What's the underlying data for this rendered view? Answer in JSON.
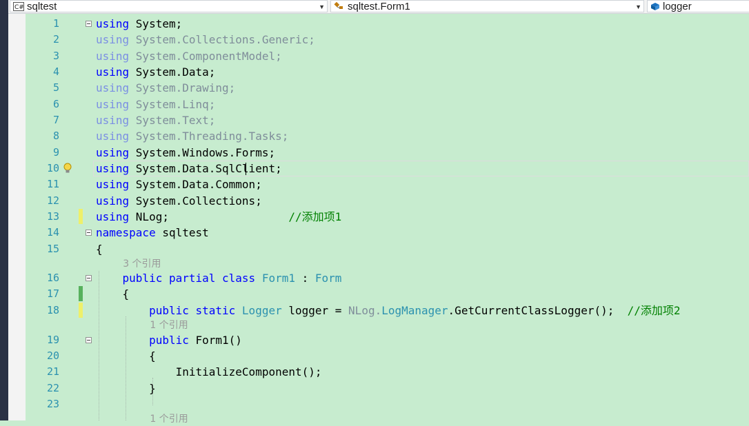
{
  "nav": {
    "project": "sqltest",
    "project_icon": "C#",
    "class": "sqltest.Form1",
    "member": "logger"
  },
  "colors": {
    "keyword": "#0000ff",
    "type": "#2b91af",
    "comment": "#008000",
    "line_number": "#2b91af",
    "background": "#c7eccf",
    "change_saved": "#57b15d",
    "change_unsaved": "#eef06a"
  },
  "lines": [
    {
      "num": "1",
      "parts": [
        [
          "kw",
          "using"
        ],
        [
          "",
          "System;"
        ]
      ]
    },
    {
      "num": "2",
      "parts": [
        [
          "dimkw",
          "using"
        ],
        [
          "dim",
          "System.Collections.Generic;"
        ]
      ]
    },
    {
      "num": "3",
      "parts": [
        [
          "dimkw",
          "using"
        ],
        [
          "dim",
          "System.ComponentModel;"
        ]
      ]
    },
    {
      "num": "4",
      "parts": [
        [
          "kw",
          "using"
        ],
        [
          "",
          "System.Data;"
        ]
      ]
    },
    {
      "num": "5",
      "parts": [
        [
          "dimkw",
          "using"
        ],
        [
          "dim",
          "System.Drawing;"
        ]
      ]
    },
    {
      "num": "6",
      "parts": [
        [
          "dimkw",
          "using"
        ],
        [
          "dim",
          "System.Linq;"
        ]
      ]
    },
    {
      "num": "7",
      "parts": [
        [
          "dimkw",
          "using"
        ],
        [
          "dim",
          "System.Text;"
        ]
      ]
    },
    {
      "num": "8",
      "parts": [
        [
          "dimkw",
          "using"
        ],
        [
          "dim",
          "System.Threading.Tasks;"
        ]
      ]
    },
    {
      "num": "9",
      "parts": [
        [
          "kw",
          "using"
        ],
        [
          "",
          "System.Windows.Forms;"
        ]
      ]
    },
    {
      "num": "10",
      "parts": [
        [
          "kw",
          "using"
        ],
        [
          "",
          "System.Data.SqlClient;"
        ]
      ]
    },
    {
      "num": "11",
      "parts": [
        [
          "kw",
          "using"
        ],
        [
          "",
          "System.Data.Common;"
        ]
      ]
    },
    {
      "num": "12",
      "parts": [
        [
          "kw",
          "using"
        ],
        [
          "",
          "System.Collections;"
        ]
      ]
    },
    {
      "num": "13",
      "parts": [
        [
          "kw",
          "using"
        ],
        [
          "",
          "NLog;                  "
        ],
        [
          "cm",
          "//添加项1"
        ]
      ]
    },
    {
      "num": "14",
      "parts": [
        [
          "kw",
          "namespace"
        ],
        [
          "",
          "sqltest"
        ]
      ]
    },
    {
      "num": "15",
      "parts": [
        [
          "",
          "{"
        ]
      ]
    },
    {
      "lens": "3 个引用"
    },
    {
      "num": "16",
      "parts": [
        [
          "",
          "    "
        ],
        [
          "kw",
          "public partial class"
        ],
        [
          "ty",
          "Form1"
        ],
        [
          "",
          " : "
        ],
        [
          "ty",
          "Form"
        ]
      ]
    },
    {
      "num": "17",
      "parts": [
        [
          "",
          "    {"
        ]
      ]
    },
    {
      "num": "18",
      "parts": [
        [
          "",
          "        "
        ],
        [
          "kw",
          "public static"
        ],
        [
          "ty",
          "Logger"
        ],
        [
          "",
          " logger = "
        ],
        [
          "dim",
          "NLog."
        ],
        [
          "ty",
          "LogManager"
        ],
        [
          "",
          ".GetCurrentClassLogger();  "
        ],
        [
          "cm",
          "//添加项2"
        ]
      ]
    },
    {
      "lens": "1 个引用"
    },
    {
      "num": "19",
      "parts": [
        [
          "",
          "        "
        ],
        [
          "kw",
          "public"
        ],
        [
          "",
          "Form1()"
        ]
      ]
    },
    {
      "num": "20",
      "parts": [
        [
          "",
          "        {"
        ]
      ]
    },
    {
      "num": "21",
      "parts": [
        [
          "",
          "            InitializeComponent();"
        ]
      ]
    },
    {
      "num": "22",
      "parts": [
        [
          "",
          "        }"
        ]
      ]
    },
    {
      "num": "23",
      "parts": []
    },
    {
      "lens": "1 个引用"
    }
  ]
}
